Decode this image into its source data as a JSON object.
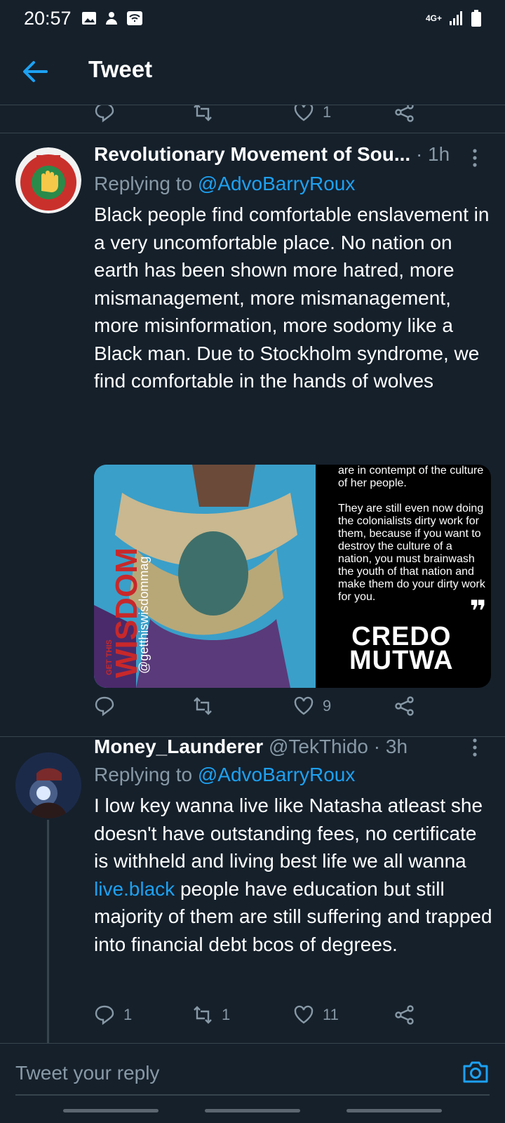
{
  "status_bar": {
    "time": "20:57",
    "network": "4G+"
  },
  "app_bar": {
    "title": "Tweet"
  },
  "previous_tweet": {
    "likes": "1"
  },
  "tweets": [
    {
      "name": "Revolutionary Movement of Sou...",
      "time": "· 1h",
      "replying_label": "Replying to",
      "replying_to": "@AdvoBarryRoux",
      "text": "Black people find comfortable enslavement in a very uncomfortable place. No nation on earth has been shown more hatred, more mismanagement, more mismanagement, more misinformation, more sodomy like a Black man. Due to Stockholm syndrome, we find comfortable in the hands of wolves",
      "image": {
        "quote_top": "are in contempt of the culture of her people.",
        "quote_body": "They are still even now doing the colonialists dirty work for them, because if you want to destroy the culture of a nation, you must brainwash the youth of that nation and make them do your dirty work for you.",
        "quote_mark": "❞",
        "author_line1": "CREDO",
        "author_line2": "MUTWA",
        "brand": "WISDOM",
        "brand_prefix": "GET THIS",
        "brand_handle": "@getthiswisdommag"
      },
      "likes": "9"
    },
    {
      "name": "Money_Launderer",
      "handle": "@TekThido",
      "time": "· 3h",
      "replying_label": "Replying to",
      "replying_to": "@AdvoBarryRoux",
      "text_before": "I low key wanna live like Natasha atleast she doesn't have outstanding fees, no certificate is withheld and living best life we all wanna ",
      "text_link": "live.black",
      "text_after": " people have education but still majority of them are still suffering and trapped into financial debt bcos of degrees.",
      "replies": "1",
      "retweets": "1",
      "likes": "11"
    }
  ],
  "composer": {
    "placeholder": "Tweet your reply"
  },
  "colors": {
    "background": "#15202b",
    "accent": "#1da1f2",
    "muted": "#8899a6",
    "divider": "#38444d"
  }
}
